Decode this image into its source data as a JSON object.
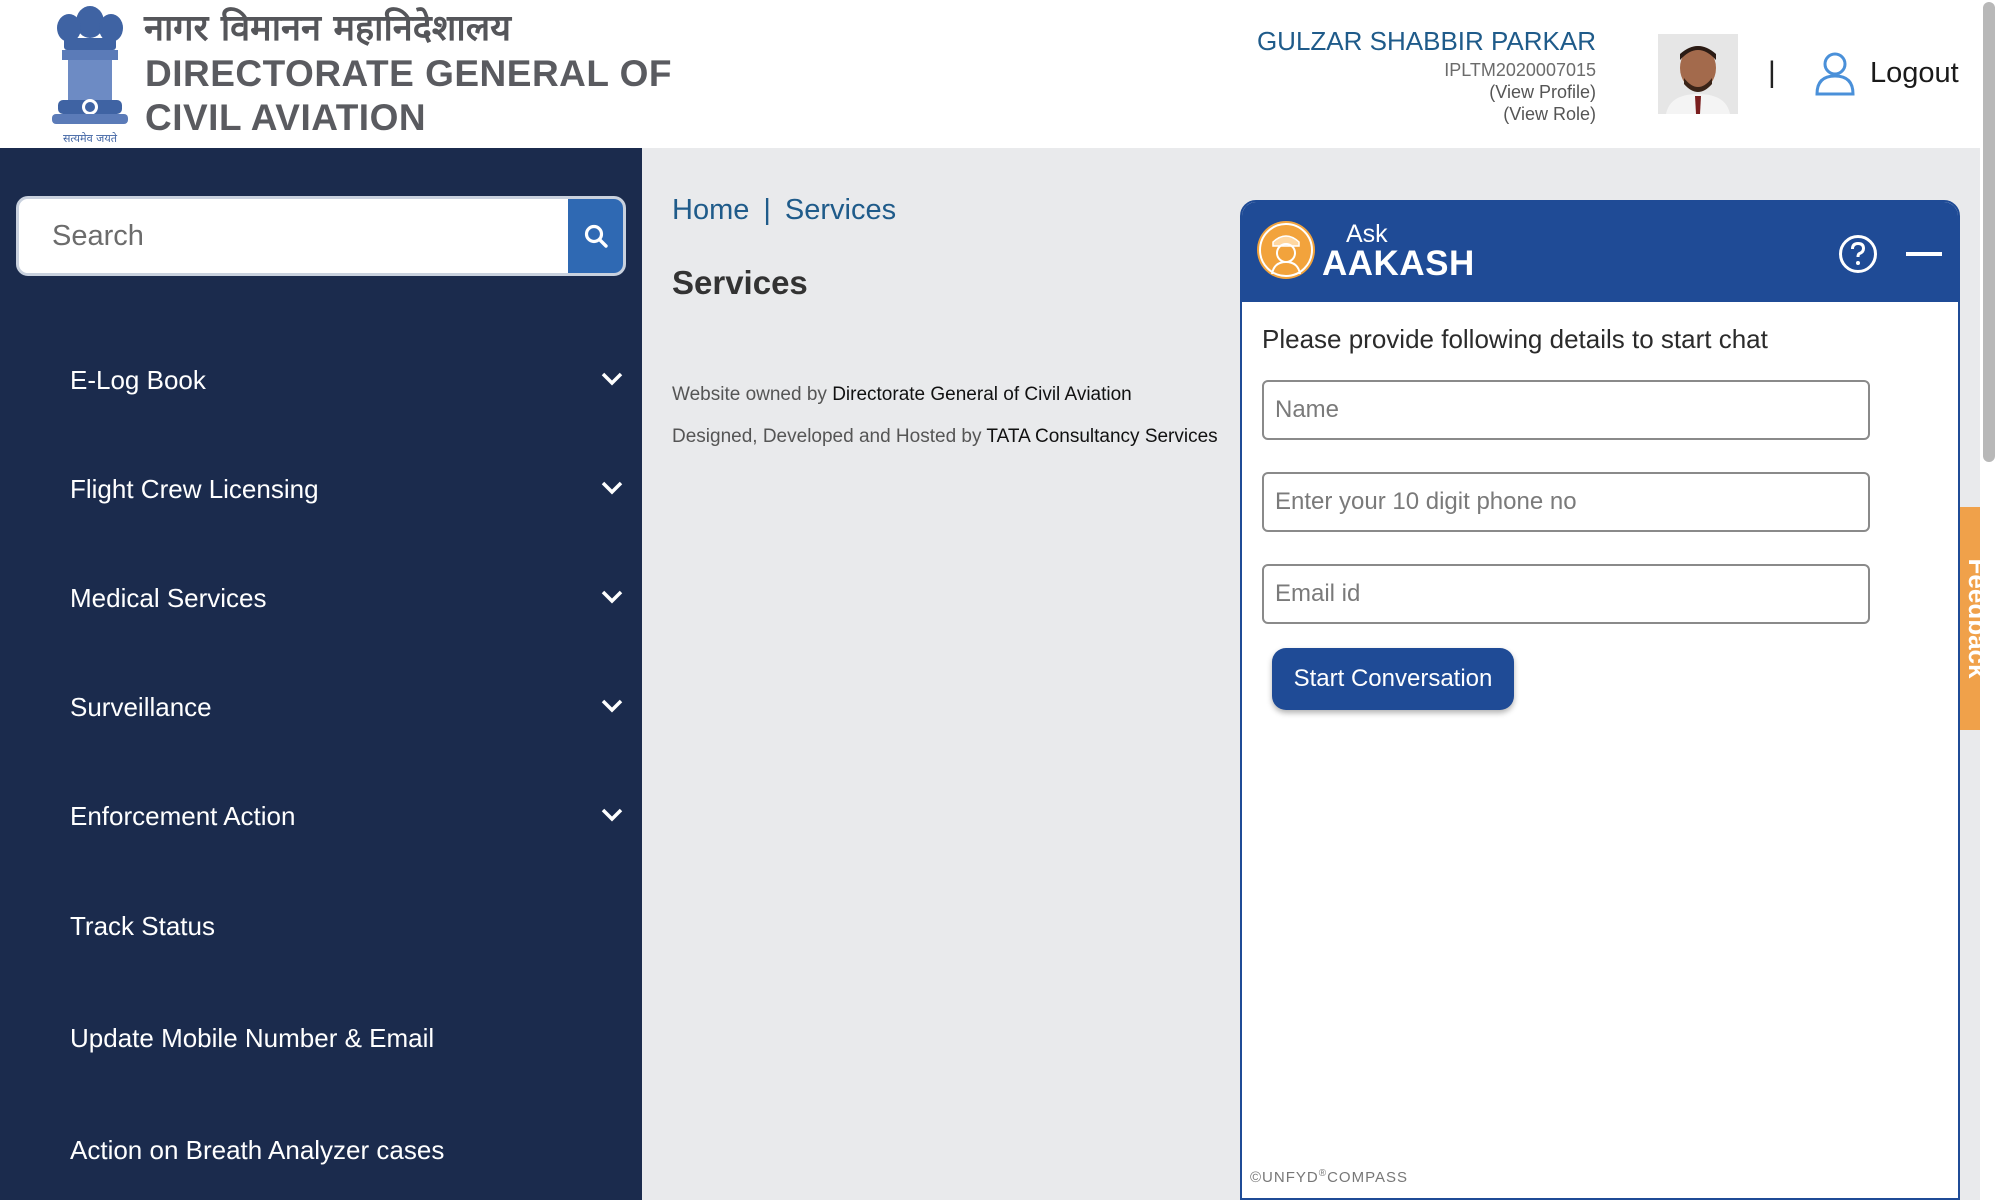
{
  "header": {
    "title_hindi": "नागर विमानन महानिदेशालय",
    "title_line1": "DIRECTORATE GENERAL OF",
    "title_line2": "CIVIL AVIATION",
    "emblem_motto": "सत्यमेव जयते",
    "user": {
      "name": "GULZAR SHABBIR PARKAR",
      "id": "IPLTM2020007015",
      "view_profile": "(View Profile)",
      "view_role": "(View Role)"
    },
    "separator": "|",
    "logout_label": "Logout"
  },
  "sidebar": {
    "search_placeholder": "Search",
    "items": [
      {
        "label": "E-Log Book",
        "expandable": true
      },
      {
        "label": "Flight Crew Licensing",
        "expandable": true
      },
      {
        "label": "Medical Services",
        "expandable": true
      },
      {
        "label": "Surveillance",
        "expandable": true
      },
      {
        "label": "Enforcement Action",
        "expandable": true
      },
      {
        "label": "Track Status",
        "expandable": false
      },
      {
        "label": "Update Mobile Number & Email",
        "expandable": false
      },
      {
        "label": "Action on Breath Analyzer cases",
        "expandable": false
      }
    ]
  },
  "main": {
    "breadcrumb": {
      "home": "Home",
      "separator": "|",
      "current": "Services"
    },
    "page_title": "Services",
    "footer": {
      "owned_prefix": "Website owned by ",
      "owned_by": "Directorate General of Civil Aviation",
      "hosted_prefix": "Designed, Developed and Hosted by ",
      "hosted_by": "TATA Consultancy Services"
    }
  },
  "chat": {
    "ask_label": "Ask",
    "brand": "AAKASH",
    "prompt": "Please provide following details to start chat",
    "name_placeholder": "Name",
    "phone_placeholder": "Enter your 10 digit phone no",
    "email_placeholder": "Email id",
    "start_button": "Start Conversation",
    "footer_prefix": "©UNFYD",
    "footer_mark": "®",
    "footer_suffix": "COMPASS"
  },
  "feedback_label": "Feedback",
  "colors": {
    "sidebar_bg": "#1b2b4d",
    "chat_header": "#1f4b96",
    "link_blue": "#1f5b8a",
    "feedback_orange": "#f0a14a",
    "content_bg": "#e9eaec"
  }
}
